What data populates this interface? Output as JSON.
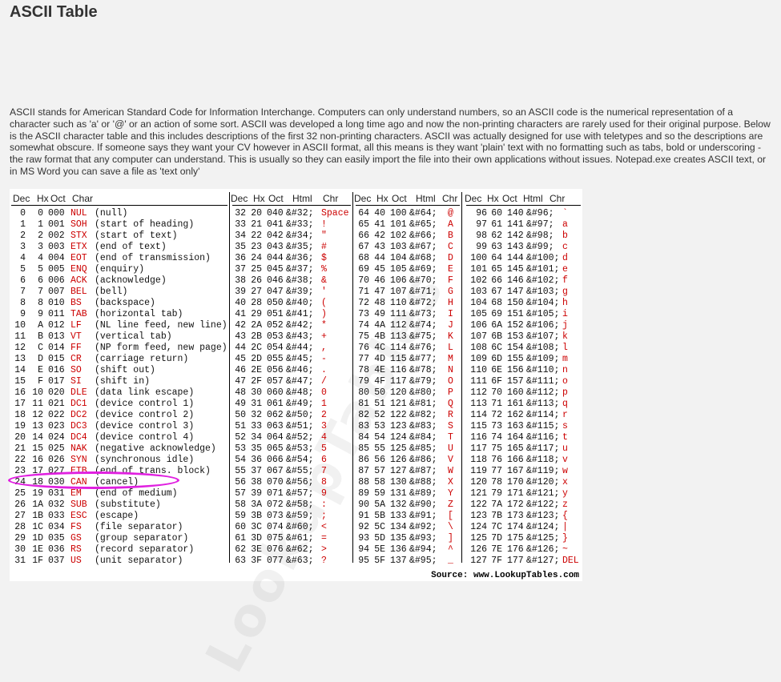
{
  "title": "ASCII Table",
  "intro": "ASCII stands for American Standard Code for Information Interchange. Computers can only understand numbers, so an ASCII code is the numerical representation of a character such as 'a' or '@' or an action of some sort. ASCII was developed a long time ago and now the non-printing characters are rarely used for their original purpose. Below is the ASCII character table and this includes descriptions of the first 32 non-printing characters. ASCII was actually designed for use with teletypes and so the descriptions are somewhat obscure. If someone says they want your CV however in ASCII format, all this means is they want 'plain' text with no formatting such as tabs, bold or underscoring - the raw format that any computer can understand. This is usually so they can easily import the file into their own applications without issues. Notepad.exe creates ASCII text, or in MS Word you can save a file as 'text only'",
  "colors": {
    "red": "#cc0000",
    "highlight": "#e020e0"
  },
  "table": {
    "header1": [
      "Dec",
      "Hx",
      "Oct",
      "Char"
    ],
    "header2": [
      "Dec",
      "Hx",
      "Oct",
      "Html",
      "Chr"
    ],
    "source": "Source: www.LookupTables.com",
    "watermark": "LookupTables",
    "col1": [
      [
        "0",
        "0",
        "000",
        "NUL",
        "(null)"
      ],
      [
        "1",
        "1",
        "001",
        "SOH",
        "(start of heading)"
      ],
      [
        "2",
        "2",
        "002",
        "STX",
        "(start of text)"
      ],
      [
        "3",
        "3",
        "003",
        "ETX",
        "(end of text)"
      ],
      [
        "4",
        "4",
        "004",
        "EOT",
        "(end of transmission)"
      ],
      [
        "5",
        "5",
        "005",
        "ENQ",
        "(enquiry)"
      ],
      [
        "6",
        "6",
        "006",
        "ACK",
        "(acknowledge)"
      ],
      [
        "7",
        "7",
        "007",
        "BEL",
        "(bell)"
      ],
      [
        "8",
        "8",
        "010",
        "BS",
        "(backspace)"
      ],
      [
        "9",
        "9",
        "011",
        "TAB",
        "(horizontal tab)"
      ],
      [
        "10",
        "A",
        "012",
        "LF",
        "(NL line feed, new line)"
      ],
      [
        "11",
        "B",
        "013",
        "VT",
        "(vertical tab)"
      ],
      [
        "12",
        "C",
        "014",
        "FF",
        "(NP form feed, new page)"
      ],
      [
        "13",
        "D",
        "015",
        "CR",
        "(carriage return)"
      ],
      [
        "14",
        "E",
        "016",
        "SO",
        "(shift out)"
      ],
      [
        "15",
        "F",
        "017",
        "SI",
        "(shift in)"
      ],
      [
        "16",
        "10",
        "020",
        "DLE",
        "(data link escape)"
      ],
      [
        "17",
        "11",
        "021",
        "DC1",
        "(device control 1)"
      ],
      [
        "18",
        "12",
        "022",
        "DC2",
        "(device control 2)"
      ],
      [
        "19",
        "13",
        "023",
        "DC3",
        "(device control 3)"
      ],
      [
        "20",
        "14",
        "024",
        "DC4",
        "(device control 4)"
      ],
      [
        "21",
        "15",
        "025",
        "NAK",
        "(negative acknowledge)"
      ],
      [
        "22",
        "16",
        "026",
        "SYN",
        "(synchronous idle)"
      ],
      [
        "23",
        "17",
        "027",
        "ETB",
        "(end of trans. block)"
      ],
      [
        "24",
        "18",
        "030",
        "CAN",
        "(cancel)"
      ],
      [
        "25",
        "19",
        "031",
        "EM",
        "(end of medium)"
      ],
      [
        "26",
        "1A",
        "032",
        "SUB",
        "(substitute)"
      ],
      [
        "27",
        "1B",
        "033",
        "ESC",
        "(escape)"
      ],
      [
        "28",
        "1C",
        "034",
        "FS",
        "(file separator)"
      ],
      [
        "29",
        "1D",
        "035",
        "GS",
        "(group separator)"
      ],
      [
        "30",
        "1E",
        "036",
        "RS",
        "(record separator)"
      ],
      [
        "31",
        "1F",
        "037",
        "US",
        "(unit separator)"
      ]
    ],
    "col2": [
      [
        "32",
        "20",
        "040",
        "&#32;",
        "Space"
      ],
      [
        "33",
        "21",
        "041",
        "&#33;",
        "!"
      ],
      [
        "34",
        "22",
        "042",
        "&#34;",
        "\""
      ],
      [
        "35",
        "23",
        "043",
        "&#35;",
        "#"
      ],
      [
        "36",
        "24",
        "044",
        "&#36;",
        "$"
      ],
      [
        "37",
        "25",
        "045",
        "&#37;",
        "%"
      ],
      [
        "38",
        "26",
        "046",
        "&#38;",
        "&"
      ],
      [
        "39",
        "27",
        "047",
        "&#39;",
        "'"
      ],
      [
        "40",
        "28",
        "050",
        "&#40;",
        "("
      ],
      [
        "41",
        "29",
        "051",
        "&#41;",
        ")"
      ],
      [
        "42",
        "2A",
        "052",
        "&#42;",
        "*"
      ],
      [
        "43",
        "2B",
        "053",
        "&#43;",
        "+"
      ],
      [
        "44",
        "2C",
        "054",
        "&#44;",
        ","
      ],
      [
        "45",
        "2D",
        "055",
        "&#45;",
        "-"
      ],
      [
        "46",
        "2E",
        "056",
        "&#46;",
        "."
      ],
      [
        "47",
        "2F",
        "057",
        "&#47;",
        "/"
      ],
      [
        "48",
        "30",
        "060",
        "&#48;",
        "0"
      ],
      [
        "49",
        "31",
        "061",
        "&#49;",
        "1"
      ],
      [
        "50",
        "32",
        "062",
        "&#50;",
        "2"
      ],
      [
        "51",
        "33",
        "063",
        "&#51;",
        "3"
      ],
      [
        "52",
        "34",
        "064",
        "&#52;",
        "4"
      ],
      [
        "53",
        "35",
        "065",
        "&#53;",
        "5"
      ],
      [
        "54",
        "36",
        "066",
        "&#54;",
        "6"
      ],
      [
        "55",
        "37",
        "067",
        "&#55;",
        "7"
      ],
      [
        "56",
        "38",
        "070",
        "&#56;",
        "8"
      ],
      [
        "57",
        "39",
        "071",
        "&#57;",
        "9"
      ],
      [
        "58",
        "3A",
        "072",
        "&#58;",
        ":"
      ],
      [
        "59",
        "3B",
        "073",
        "&#59;",
        ";"
      ],
      [
        "60",
        "3C",
        "074",
        "&#60;",
        "<"
      ],
      [
        "61",
        "3D",
        "075",
        "&#61;",
        "="
      ],
      [
        "62",
        "3E",
        "076",
        "&#62;",
        ">"
      ],
      [
        "63",
        "3F",
        "077",
        "&#63;",
        "?"
      ]
    ],
    "col3": [
      [
        "64",
        "40",
        "100",
        "&#64;",
        "@"
      ],
      [
        "65",
        "41",
        "101",
        "&#65;",
        "A"
      ],
      [
        "66",
        "42",
        "102",
        "&#66;",
        "B"
      ],
      [
        "67",
        "43",
        "103",
        "&#67;",
        "C"
      ],
      [
        "68",
        "44",
        "104",
        "&#68;",
        "D"
      ],
      [
        "69",
        "45",
        "105",
        "&#69;",
        "E"
      ],
      [
        "70",
        "46",
        "106",
        "&#70;",
        "F"
      ],
      [
        "71",
        "47",
        "107",
        "&#71;",
        "G"
      ],
      [
        "72",
        "48",
        "110",
        "&#72;",
        "H"
      ],
      [
        "73",
        "49",
        "111",
        "&#73;",
        "I"
      ],
      [
        "74",
        "4A",
        "112",
        "&#74;",
        "J"
      ],
      [
        "75",
        "4B",
        "113",
        "&#75;",
        "K"
      ],
      [
        "76",
        "4C",
        "114",
        "&#76;",
        "L"
      ],
      [
        "77",
        "4D",
        "115",
        "&#77;",
        "M"
      ],
      [
        "78",
        "4E",
        "116",
        "&#78;",
        "N"
      ],
      [
        "79",
        "4F",
        "117",
        "&#79;",
        "O"
      ],
      [
        "80",
        "50",
        "120",
        "&#80;",
        "P"
      ],
      [
        "81",
        "51",
        "121",
        "&#81;",
        "Q"
      ],
      [
        "82",
        "52",
        "122",
        "&#82;",
        "R"
      ],
      [
        "83",
        "53",
        "123",
        "&#83;",
        "S"
      ],
      [
        "84",
        "54",
        "124",
        "&#84;",
        "T"
      ],
      [
        "85",
        "55",
        "125",
        "&#85;",
        "U"
      ],
      [
        "86",
        "56",
        "126",
        "&#86;",
        "V"
      ],
      [
        "87",
        "57",
        "127",
        "&#87;",
        "W"
      ],
      [
        "88",
        "58",
        "130",
        "&#88;",
        "X"
      ],
      [
        "89",
        "59",
        "131",
        "&#89;",
        "Y"
      ],
      [
        "90",
        "5A",
        "132",
        "&#90;",
        "Z"
      ],
      [
        "91",
        "5B",
        "133",
        "&#91;",
        "["
      ],
      [
        "92",
        "5C",
        "134",
        "&#92;",
        "\\"
      ],
      [
        "93",
        "5D",
        "135",
        "&#93;",
        "]"
      ],
      [
        "94",
        "5E",
        "136",
        "&#94;",
        "^"
      ],
      [
        "95",
        "5F",
        "137",
        "&#95;",
        "_"
      ]
    ],
    "col4": [
      [
        "96",
        "60",
        "140",
        "&#96;",
        "`"
      ],
      [
        "97",
        "61",
        "141",
        "&#97;",
        "a"
      ],
      [
        "98",
        "62",
        "142",
        "&#98;",
        "b"
      ],
      [
        "99",
        "63",
        "143",
        "&#99;",
        "c"
      ],
      [
        "100",
        "64",
        "144",
        "&#100;",
        "d"
      ],
      [
        "101",
        "65",
        "145",
        "&#101;",
        "e"
      ],
      [
        "102",
        "66",
        "146",
        "&#102;",
        "f"
      ],
      [
        "103",
        "67",
        "147",
        "&#103;",
        "g"
      ],
      [
        "104",
        "68",
        "150",
        "&#104;",
        "h"
      ],
      [
        "105",
        "69",
        "151",
        "&#105;",
        "i"
      ],
      [
        "106",
        "6A",
        "152",
        "&#106;",
        "j"
      ],
      [
        "107",
        "6B",
        "153",
        "&#107;",
        "k"
      ],
      [
        "108",
        "6C",
        "154",
        "&#108;",
        "l"
      ],
      [
        "109",
        "6D",
        "155",
        "&#109;",
        "m"
      ],
      [
        "110",
        "6E",
        "156",
        "&#110;",
        "n"
      ],
      [
        "111",
        "6F",
        "157",
        "&#111;",
        "o"
      ],
      [
        "112",
        "70",
        "160",
        "&#112;",
        "p"
      ],
      [
        "113",
        "71",
        "161",
        "&#113;",
        "q"
      ],
      [
        "114",
        "72",
        "162",
        "&#114;",
        "r"
      ],
      [
        "115",
        "73",
        "163",
        "&#115;",
        "s"
      ],
      [
        "116",
        "74",
        "164",
        "&#116;",
        "t"
      ],
      [
        "117",
        "75",
        "165",
        "&#117;",
        "u"
      ],
      [
        "118",
        "76",
        "166",
        "&#118;",
        "v"
      ],
      [
        "119",
        "77",
        "167",
        "&#119;",
        "w"
      ],
      [
        "120",
        "78",
        "170",
        "&#120;",
        "x"
      ],
      [
        "121",
        "79",
        "171",
        "&#121;",
        "y"
      ],
      [
        "122",
        "7A",
        "172",
        "&#122;",
        "z"
      ],
      [
        "123",
        "7B",
        "173",
        "&#123;",
        "{"
      ],
      [
        "124",
        "7C",
        "174",
        "&#124;",
        "|"
      ],
      [
        "125",
        "7D",
        "175",
        "&#125;",
        "}"
      ],
      [
        "126",
        "7E",
        "176",
        "&#126;",
        "~"
      ],
      [
        "127",
        "7F",
        "177",
        "&#127;",
        "DEL"
      ]
    ]
  }
}
